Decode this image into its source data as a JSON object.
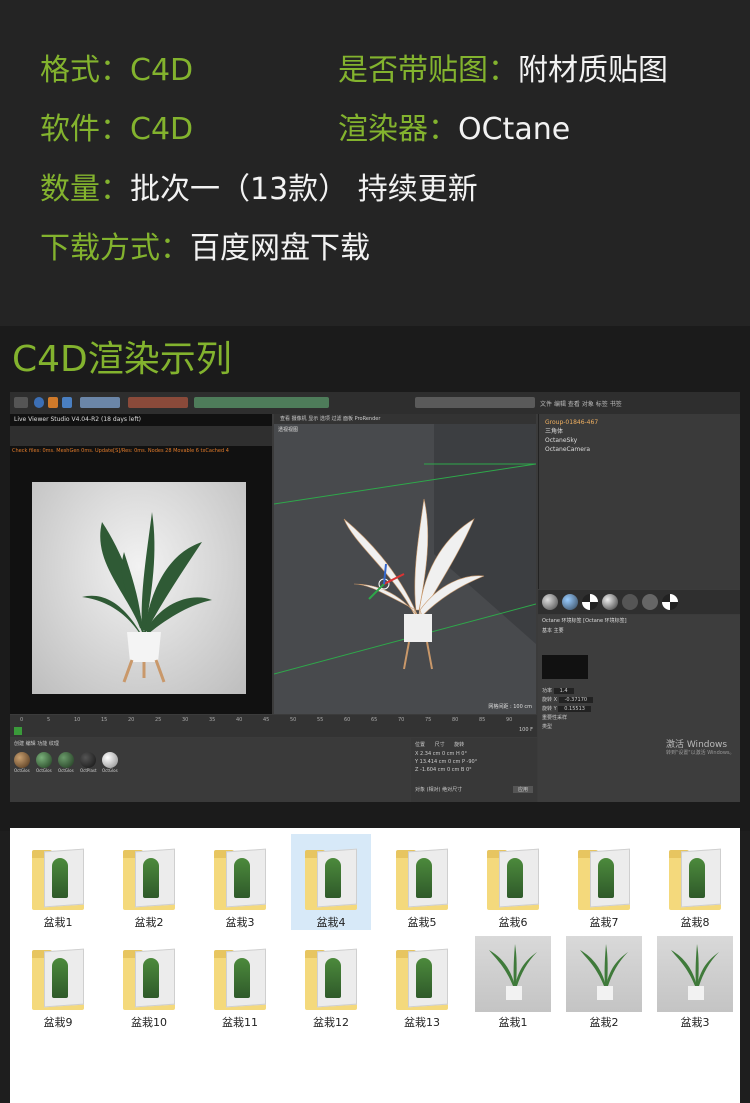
{
  "header": {
    "format_label": "格式：",
    "format_value": "C4D",
    "maps_label": "是否带贴图：",
    "maps_value": "附材质贴图",
    "software_label": "软件：",
    "software_value": "C4D",
    "renderer_label": "渲染器：",
    "renderer_value": "OCtane",
    "quantity_label": "数量：",
    "quantity_value": "批次一（13款） 持续更新",
    "download_label": "下载方式：",
    "download_value": "百度网盘下载"
  },
  "section_title": "C4D渲染示列",
  "c4d": {
    "live_viewer_title": "Live Viewer Studio V4.04-R2 (18 days left)",
    "status_line": "Check files: 0ms. MeshGen 0ms. Update[S]/Res: 0ms. Nodes 28 Movable 6 txCached 4",
    "viewport_menu": [
      "查看",
      "摄像机",
      "显示",
      "选项",
      "过滤",
      "面板",
      "ProRender"
    ],
    "viewport_label": "透视视图",
    "viewport_grid": "网格间距 : 100 cm",
    "object_menu": [
      "文件",
      "编辑",
      "查看",
      "对象",
      "标签",
      "书签"
    ],
    "objects": [
      "Group-01846-467",
      "三角体",
      "OctaneSky",
      "OctaneCamera"
    ],
    "material_menu": [
      "创建",
      "编辑",
      "功能",
      "纹理"
    ],
    "materials": [
      "OctGlos",
      "OctGlos",
      "OctGlos",
      "OctPlast",
      "OctGlos"
    ],
    "timeline_ticks": [
      "0",
      "5",
      "10",
      "15",
      "20",
      "25",
      "30",
      "35",
      "40",
      "45",
      "50",
      "55",
      "60",
      "65",
      "70",
      "75",
      "80",
      "85",
      "90"
    ],
    "frame_start": "0 F",
    "frame_end": "100 F",
    "attr_header": "Octane 环境标签 [Octane 环境标签]",
    "attr_tabs": [
      "基本",
      "主要"
    ],
    "attr_fields": [
      "类型",
      "功率",
      "旋转 X",
      "旋转 Y",
      "重要性采样",
      "类型"
    ],
    "attr_values": [
      "1.4",
      "-0.37170",
      "0.15513"
    ],
    "coords_headers": [
      "位置",
      "尺寸",
      "旋转"
    ],
    "coords_x": [
      "2.34 cm",
      "0 cm",
      "H 0°"
    ],
    "coords_y": [
      "13.414 cm",
      "0 cm",
      "P -90°"
    ],
    "coords_z": [
      "-1.604 cm",
      "0 cm",
      "B 0°"
    ],
    "coords_mode": [
      "对象 (相对)",
      "绝对尺寸"
    ],
    "apply_button": "应用",
    "activate_line1": "激活 Windows",
    "activate_line2": "转到\"设置\"以激活 Windows。"
  },
  "files": [
    {
      "label": "盆栽1",
      "kind": "folder"
    },
    {
      "label": "盆栽2",
      "kind": "folder"
    },
    {
      "label": "盆栽3",
      "kind": "folder"
    },
    {
      "label": "盆栽4",
      "kind": "folder"
    },
    {
      "label": "盆栽5",
      "kind": "folder"
    },
    {
      "label": "盆栽6",
      "kind": "folder"
    },
    {
      "label": "盆栽7",
      "kind": "folder"
    },
    {
      "label": "盆栽8",
      "kind": "folder"
    },
    {
      "label": "盆栽9",
      "kind": "folder"
    },
    {
      "label": "盆栽10",
      "kind": "folder"
    },
    {
      "label": "盆栽11",
      "kind": "folder"
    },
    {
      "label": "盆栽12",
      "kind": "folder"
    },
    {
      "label": "盆栽13",
      "kind": "folder"
    },
    {
      "label": "盆栽1",
      "kind": "image"
    },
    {
      "label": "盆栽2",
      "kind": "image"
    },
    {
      "label": "盆栽3",
      "kind": "image"
    }
  ],
  "colors": {
    "accent": "#83b32e",
    "c4d_bg": "#3b3b3b",
    "selection": "#d7e9f8"
  }
}
